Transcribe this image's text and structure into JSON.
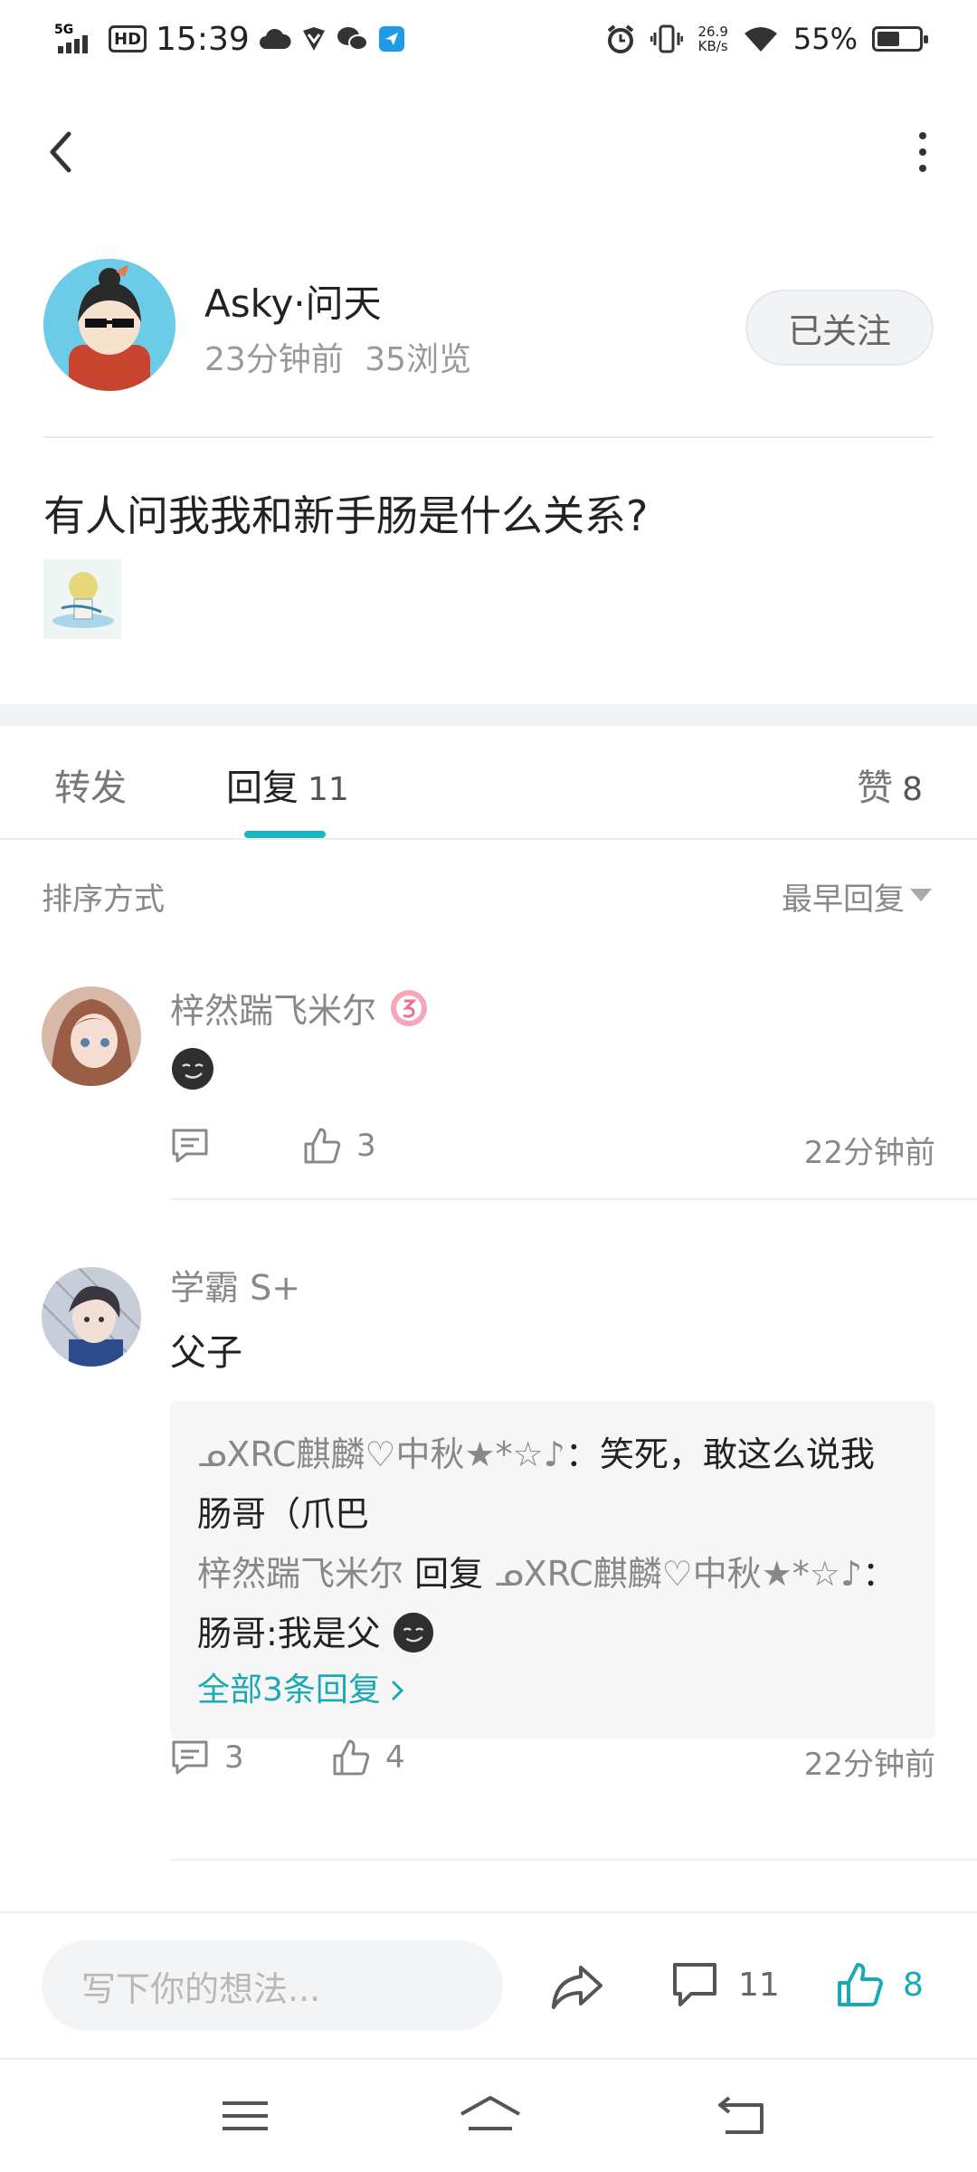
{
  "status_bar": {
    "network": "5G",
    "hd": "HD",
    "time": "15:39",
    "net_speed_value": "26.9",
    "net_speed_unit": "KB/s",
    "battery": "55%",
    "battery_level": 0.55
  },
  "post": {
    "author_name": "Asky·问天",
    "time_ago": "23分钟前",
    "views": "35浏览",
    "follow_label": "已关注",
    "title": "有人问我我和新手肠是什么关系?"
  },
  "tabs": {
    "forward_label": "转发",
    "reply_label": "回复",
    "reply_count": "11",
    "like_label": "赞",
    "like_count": "8"
  },
  "sort": {
    "label": "排序方式",
    "value": "最早回复"
  },
  "comments": [
    {
      "name": "梓然踹飞米尔",
      "text": "",
      "like_count": "3",
      "time": "22分钟前"
    },
    {
      "name": "学霸 S+",
      "text": "父子",
      "comment_count": "3",
      "like_count": "4",
      "time": "22分钟前",
      "replies": [
        {
          "author": "ᓄXRC麒麟♡中秋★*☆♪",
          "sep": "：",
          "text": "笑死，敢这么说我肠哥（爪巴"
        },
        {
          "author": "梓然踹飞米尔",
          "reply_word": "回复",
          "target": "ᓄXRC麒麟♡中秋★*☆♪",
          "sep": "：",
          "text": "肠哥:我是父"
        }
      ],
      "more_replies": "全部3条回复"
    }
  ],
  "bottom_bar": {
    "input_placeholder": "写下你的想法...",
    "comment_count": "11",
    "like_count": "8"
  },
  "colors": {
    "accent": "#1aa9b6",
    "text": "#222222",
    "muted": "#888888"
  }
}
